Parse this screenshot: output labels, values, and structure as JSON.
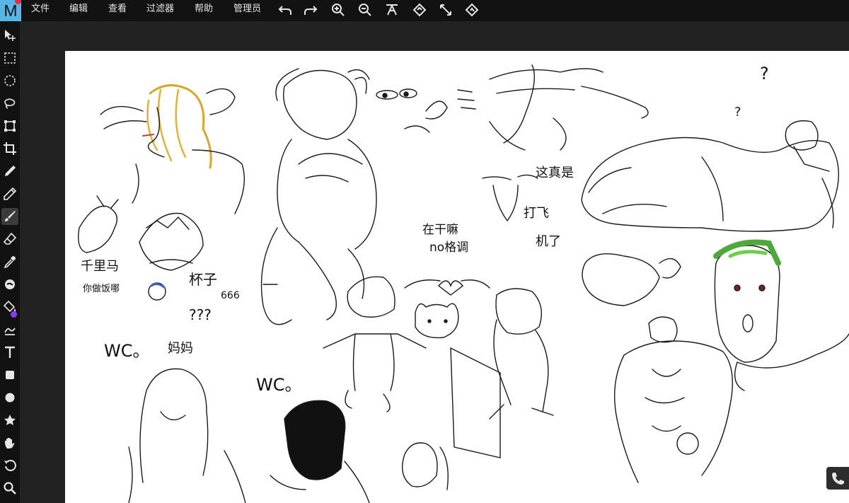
{
  "logo": {
    "letter": "M"
  },
  "menu": [
    {
      "label": "文件"
    },
    {
      "label": "编辑"
    },
    {
      "label": "查看"
    },
    {
      "label": "过滤器"
    },
    {
      "label": "帮助"
    },
    {
      "label": "管理员"
    }
  ],
  "toolbar_icons": [
    "undo-icon",
    "redo-icon",
    "zoom-in-icon",
    "zoom-out-icon",
    "fit-width-icon",
    "fit-height-icon",
    "fullscreen-icon",
    "nearest-neighbor-icon"
  ],
  "tools": [
    "move-tool-icon",
    "rect-select-icon",
    "ellipse-select-icon",
    "lasso-icon",
    "transform-icon",
    "crop-icon",
    "pen-icon",
    "pencil-icon",
    "brush-icon",
    "eraser-icon",
    "color-picker-icon",
    "smudge-icon",
    "fill-icon",
    "blur-icon",
    "text-icon",
    "rectangle-icon",
    "ellipse-icon",
    "star-icon",
    "hand-icon",
    "rotate-icon",
    "zoom-icon"
  ],
  "active_tool": "brush-icon",
  "colors": {
    "accent": "#58b6e6",
    "brush_color": "#8a3cf0",
    "hair_yellow": "#e0b43a",
    "hair_green": "#5fbf3a"
  },
  "canvas_texts": {
    "horse": "千里马",
    "dinner": "你做饭哪",
    "cup": "杯子",
    "qqq": "???",
    "num": "666",
    "wc1": "WC。",
    "mama": "妈妈",
    "wc2": "WC。",
    "q1": "?",
    "q2": "?",
    "zhe": "这真是",
    "dafei": "打飞",
    "jile": "机了",
    "zaida": "在干嘛",
    "noge": "no格调"
  }
}
